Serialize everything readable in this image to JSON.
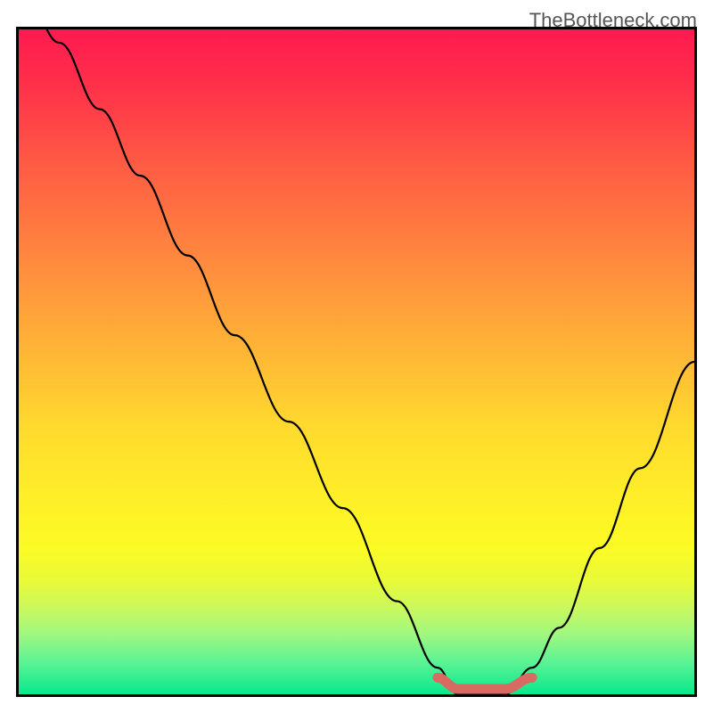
{
  "watermark": "TheBottleneck.com",
  "chart_data": {
    "type": "line",
    "title": "",
    "xlabel": "",
    "ylabel": "",
    "xlim": [
      0,
      100
    ],
    "ylim": [
      0,
      100
    ],
    "background_gradient": {
      "top": "#ff1a50",
      "middle": "#ffda2e",
      "bottom": "#08e98d"
    },
    "series": [
      {
        "name": "bottleneck-curve",
        "color": "#000000",
        "x": [
          0,
          6,
          12,
          18,
          25,
          32,
          40,
          48,
          56,
          62,
          65,
          68,
          72,
          76,
          80,
          86,
          92,
          100
        ],
        "y": [
          108,
          98,
          88,
          78,
          66,
          54,
          41,
          28,
          14,
          4,
          0,
          0,
          0,
          4,
          10,
          22,
          34,
          50
        ]
      },
      {
        "name": "minimum-plateau",
        "color": "#d86a62",
        "x": [
          62,
          65,
          68,
          72,
          76
        ],
        "y": [
          2.5,
          0.8,
          0.8,
          0.8,
          2.5
        ]
      }
    ]
  }
}
